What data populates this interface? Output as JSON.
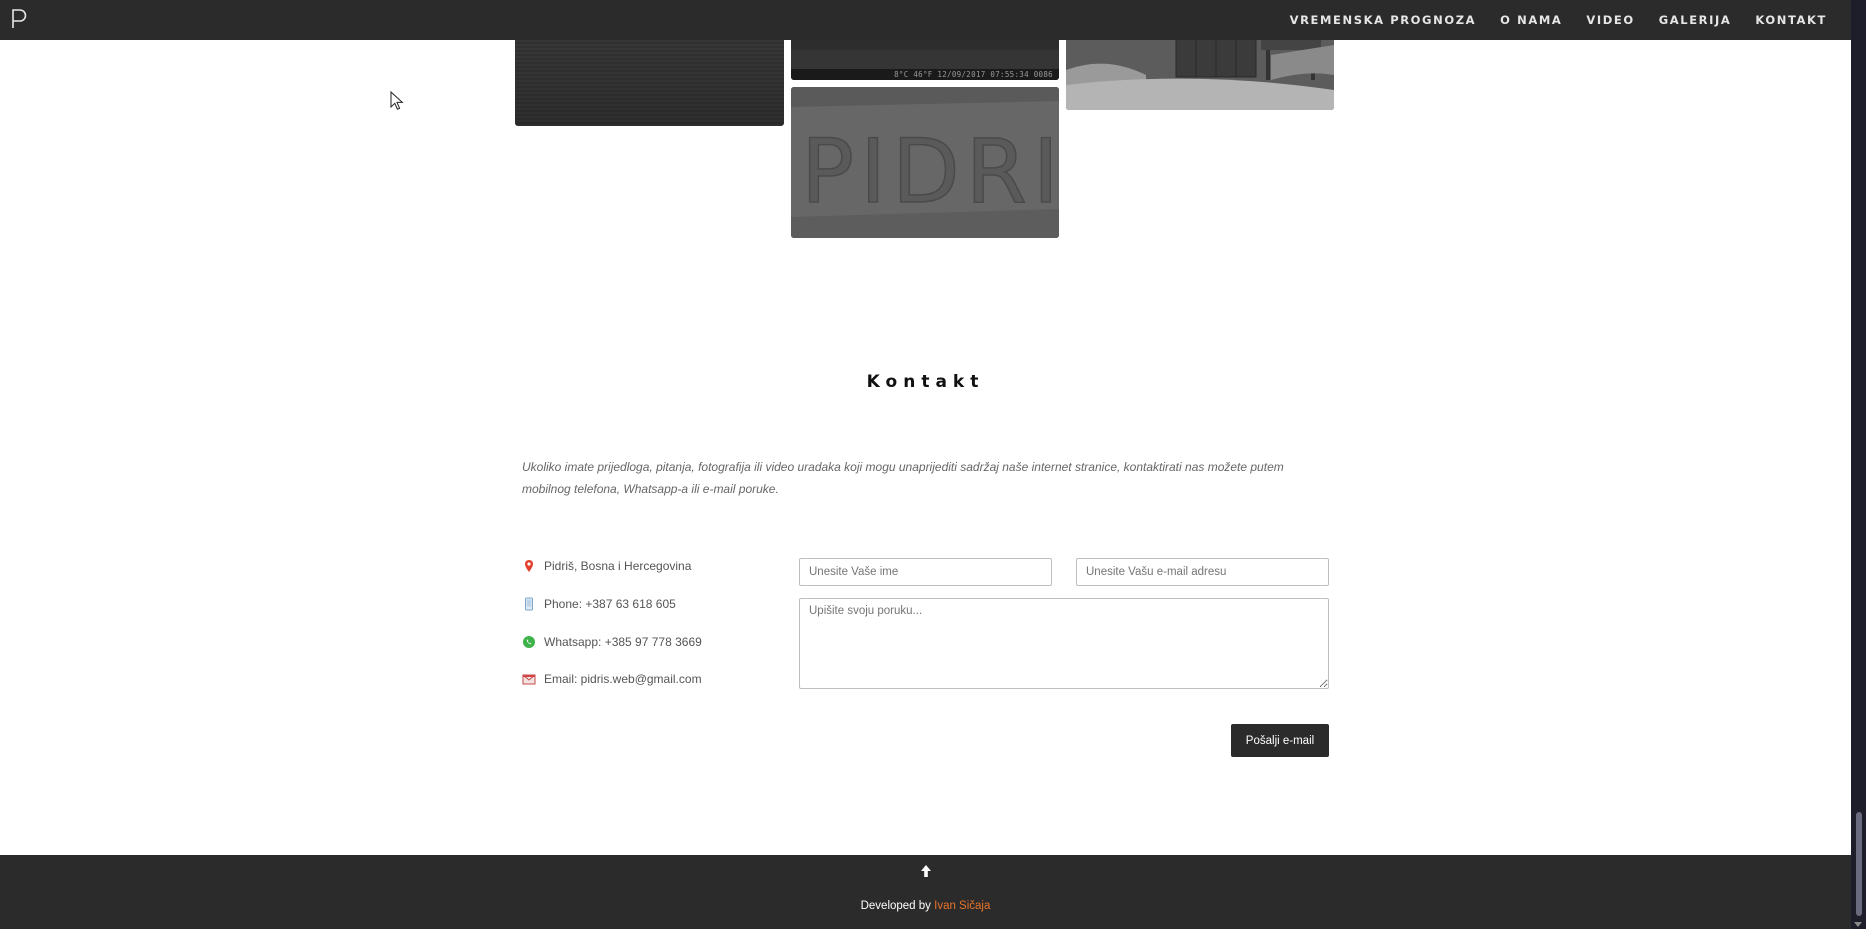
{
  "nav": {
    "logo_icon": "p-logo-icon",
    "items": [
      "VREMENSKA PROGNOZA",
      "O NAMA",
      "VIDEO",
      "GALERIJA",
      "KONTAKT"
    ]
  },
  "gallery": {
    "night_stamp": "8°C   46°F   12/09/2017  07:55:34   0086"
  },
  "contact": {
    "title": "Kontakt",
    "intro": "Ukoliko imate prijedloga, pitanja, fotografija ili video uradaka koji mogu unaprijediti sadržaj naše internet stranice, kontaktirati nas možete putem mobilnog telefona, Whatsapp-a ili e-mail poruke.",
    "info": [
      {
        "icon": "location-pin-icon",
        "text": "Pidriš, Bosna i Hercegovina"
      },
      {
        "icon": "phone-icon",
        "text": "Phone: +387 63 618 605"
      },
      {
        "icon": "whatsapp-icon",
        "text": "Whatsapp: +385 97 778 3669"
      },
      {
        "icon": "email-icon",
        "text": "Email: pidris.web@gmail.com"
      }
    ],
    "form": {
      "name_placeholder": "Unesite Vaše ime",
      "email_placeholder": "Unesite Vašu e-mail adresu",
      "message_placeholder": "Upišite svoju poruku...",
      "submit_label": "Pošalji e-mail"
    }
  },
  "footer": {
    "credit_prefix": "Developed by ",
    "credit_author": "Ivan Sičaja"
  },
  "colors": {
    "nav_bg": "#2b2b2b",
    "accent": "#e8732b",
    "pin_red": "#e2402c",
    "whatsapp_green": "#3fb34a"
  }
}
